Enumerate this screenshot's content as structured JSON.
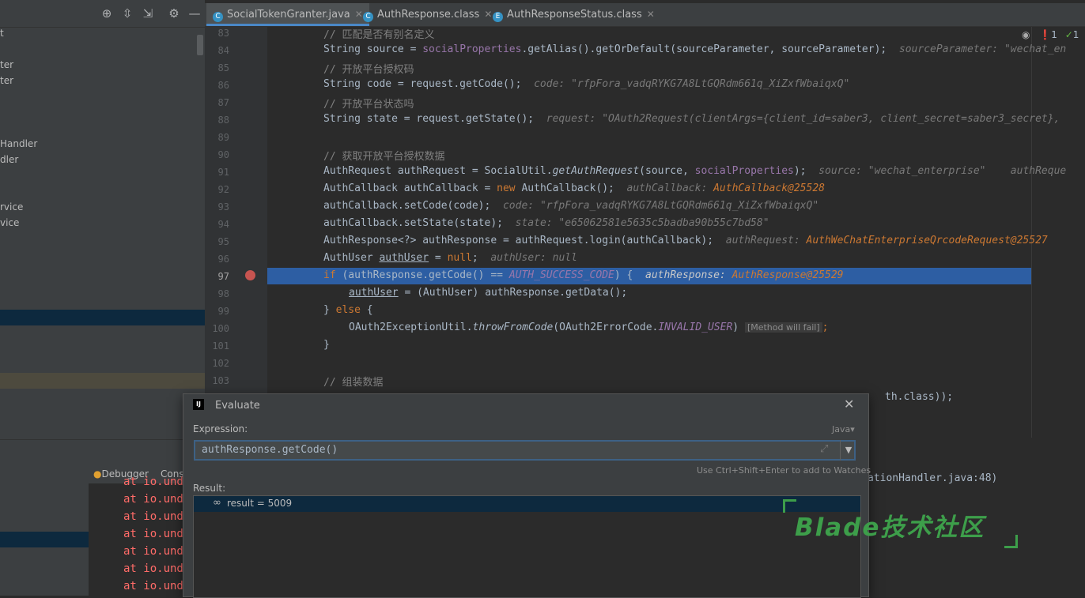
{
  "tabs": [
    {
      "icon": "C",
      "label": "SocialTokenGranter.java",
      "active": true
    },
    {
      "icon": "C",
      "label": "AuthResponse.class",
      "active": false
    },
    {
      "icon": "E",
      "label": "AuthResponseStatus.class",
      "active": false
    }
  ],
  "project_tree": [
    "t",
    "ter",
    "ter",
    "Handler",
    "dler",
    "rvice",
    "vice"
  ],
  "bottom_tabs": {
    "debugger": "Debugger",
    "console": "Cons"
  },
  "console_lines": [
    "at io.unde",
    "at io.unde",
    "at io.unde",
    "at io.unde",
    "at io.unde",
    "at io.unde"
  ],
  "status": {
    "errors": "1",
    "warnings": "1"
  },
  "line_numbers": [
    "83",
    "84",
    "85",
    "86",
    "87",
    "88",
    "89",
    "90",
    "91",
    "92",
    "93",
    "94",
    "95",
    "96",
    "97",
    "98",
    "99",
    "100",
    "101",
    "102",
    "103"
  ],
  "code": {
    "l83": "// 匹配是否有别名定义",
    "l84a": "String source = ",
    "l84b": "socialProperties",
    "l84c": ".getAlias().getOrDefault(sourceParameter, sourceParameter);",
    "l84h": "sourceParameter: \"wechat_en",
    "l85": "// 开放平台授权码",
    "l86": "String code = request.getCode();",
    "l86h": "code: \"rfpFora_vadqRYKG7A8LtGQRdm661q_XiZxfWbaiqxQ\"",
    "l87": "// 开放平台状态吗",
    "l88": "String state = request.getState();",
    "l88h": "request: \"OAuth2Request(clientArgs={client_id=saber3, client_secret=saber3_secret},",
    "l90": "// 获取开放平台授权数据",
    "l91a": "AuthRequest authRequest = SocialUtil.",
    "l91b": "getAuthRequest",
    "l91c": "(source, ",
    "l91d": "socialProperties",
    "l91e": ");",
    "l91h": "source: \"wechat_enterprise\"    authReque",
    "l92a": "AuthCallback authCallback = ",
    "l92b": "new",
    "l92c": " AuthCallback();",
    "l92h1": "authCallback: ",
    "l92h2": "AuthCallback@25528",
    "l93": "authCallback.setCode(code);",
    "l93h": "code: \"rfpFora_vadqRYKG7A8LtGQRdm661q_XiZxfWbaiqxQ\"",
    "l94": "authCallback.setState(state);",
    "l94h": "state: \"e65062581e5635c5badba90b55c7bd58\"",
    "l95": "AuthResponse<?> authResponse = authRequest.login(authCallback);",
    "l95h1": "authRequest: ",
    "l95h2": "AuthWeChatEnterpriseQrcodeRequest@25527",
    "l96a": "AuthUser ",
    "l96b": "authUser",
    "l96c": " = ",
    "l96d": "null",
    "l96e": ";",
    "l96h": "authUser: null",
    "l97a": "if",
    "l97b": " (authResponse.getCode() == ",
    "l97c": "AUTH_SUCCESS_CODE",
    "l97d": ") {",
    "l97h1": "authResponse: ",
    "l97h2": "AuthResponse@25529",
    "l98a": "authUser",
    "l98b": " = (AuthUser) authResponse.getData();",
    "l99a": "} ",
    "l99b": "else",
    "l99c": " {",
    "l100a": "OAuth2ExceptionUtil.",
    "l100b": "throwFromCode",
    "l100c": "(OAuth2ErrorCode.",
    "l100d": "INVALID_USER",
    "l100e": ")",
    "l100f": "[Method will fail]",
    "l100g": ";",
    "l101": "}",
    "l103": "// 组装数据",
    "l104": "th.class));"
  },
  "right_tail": "ationHandler.java:48)",
  "dialog": {
    "title": "Evaluate",
    "expression_label": "Expression:",
    "language": "Java",
    "expression": "authResponse.getCode()",
    "watch_hint": "Use Ctrl+Shift+Enter to add to Watches",
    "result_label": "Result:",
    "result": "result = 5009"
  },
  "watermark": "Blade技术社区",
  "colors": {
    "selection": "#2d5ea3",
    "accent": "#4a88c7",
    "watermark": "#3d9e4a"
  }
}
